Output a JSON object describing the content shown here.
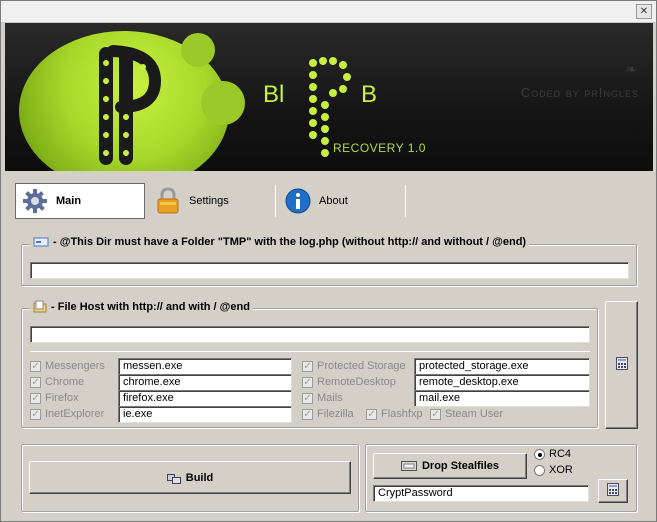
{
  "window": {
    "close_glyph": "✕"
  },
  "banner": {
    "word_left": "Bl",
    "word_right": "B",
    "version": "RECOVERY 1.0",
    "credit": "Coded by pr!ngles"
  },
  "tabs": [
    {
      "label": "Main",
      "icon": "gear-icon",
      "active": true
    },
    {
      "label": "Settings",
      "icon": "lock-icon",
      "active": false
    },
    {
      "label": "About",
      "icon": "info-icon",
      "active": false
    }
  ],
  "log_group": {
    "title": "- @This Dir must have a Folder \"TMP\" with the log.php (without http:// and without / @end)",
    "input_value": ""
  },
  "filehost_group": {
    "title": "- File Host with http:// and with / @end",
    "input_value": ""
  },
  "stealers": {
    "left": [
      {
        "label": "Messengers",
        "checked": true,
        "file": "messen.exe"
      },
      {
        "label": "Chrome",
        "checked": true,
        "file": "chrome.exe"
      },
      {
        "label": "Firefox",
        "checked": true,
        "file": "firefox.exe"
      },
      {
        "label": "InetExplorer",
        "checked": true,
        "file": "ie.exe"
      }
    ],
    "right": [
      {
        "label": "Protected Storage",
        "checked": true,
        "file": "protected_storage.exe"
      },
      {
        "label": "RemoteDesktop",
        "checked": true,
        "file": "remote_desktop.exe"
      },
      {
        "label": "Mails",
        "checked": true,
        "file": "mail.exe"
      }
    ],
    "extras": [
      {
        "label": "Filezilla",
        "checked": true
      },
      {
        "label": "Flashfxp",
        "checked": true
      },
      {
        "label": "Steam User",
        "checked": true
      }
    ]
  },
  "actions": {
    "build_label": "Build",
    "drop_label": "Drop Stealfiles",
    "crypt_password": "CryptPassword",
    "encryption": [
      {
        "label": "RC4",
        "selected": true
      },
      {
        "label": "XOR",
        "selected": false
      }
    ]
  }
}
